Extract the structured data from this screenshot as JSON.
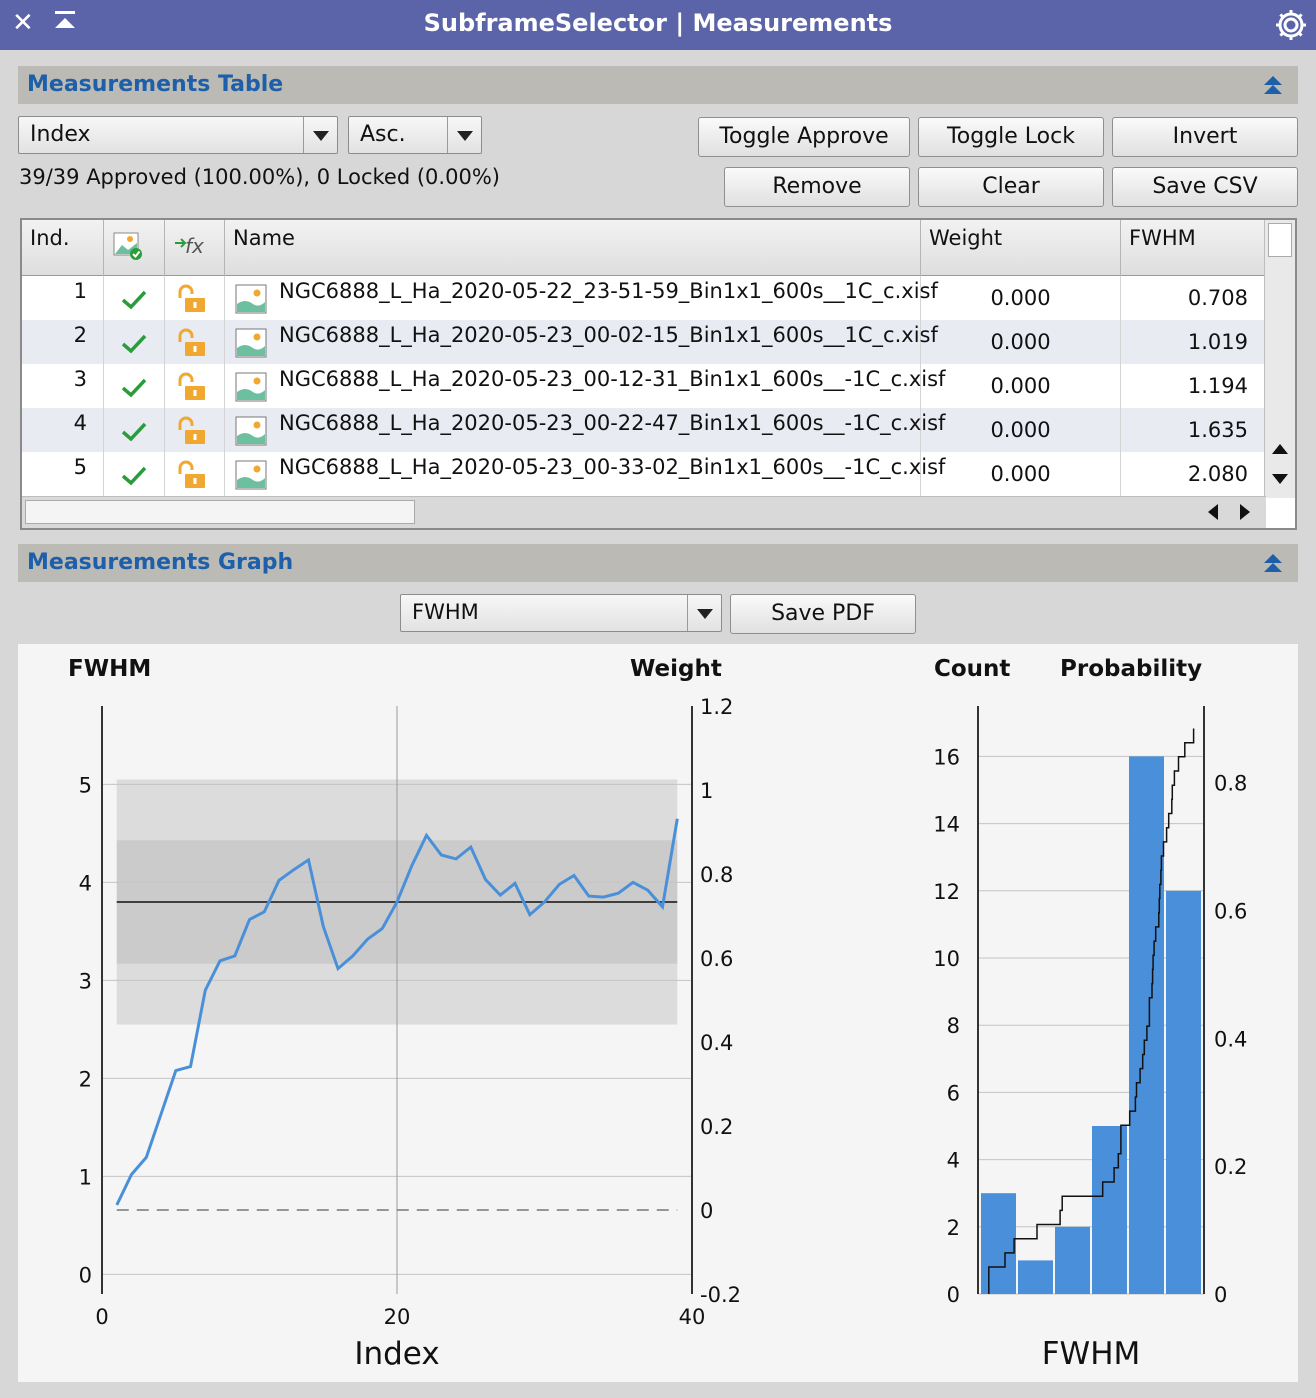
{
  "window": {
    "title": "SubframeSelector | Measurements",
    "close_icon": "close-icon",
    "shade_icon": "shade-icon",
    "settings_icon": "gear-icon"
  },
  "table_section": {
    "header": "Measurements Table",
    "sort_field": "Index",
    "sort_order": "Asc.",
    "buttons": {
      "toggle_approve": "Toggle Approve",
      "toggle_lock": "Toggle Lock",
      "invert": "Invert",
      "remove": "Remove",
      "clear": "Clear",
      "save_csv": "Save CSV"
    },
    "status": "39/39 Approved (100.00%), 0 Locked (0.00%)",
    "columns": [
      "Ind.",
      "approved-icon",
      "locked-icon",
      "Name",
      "Weight",
      "FWHM"
    ],
    "column_labels": {
      "ind": "Ind.",
      "name": "Name",
      "weight": "Weight",
      "fwhm": "FWHM"
    },
    "rows": [
      {
        "index": "1",
        "name": "NGC6888_L_Ha_2020-05-22_23-51-59_Bin1x1_600s__1C_c.xisf",
        "weight": "0.000",
        "fwhm": "0.708",
        "approved": true,
        "locked": false
      },
      {
        "index": "2",
        "name": "NGC6888_L_Ha_2020-05-23_00-02-15_Bin1x1_600s__1C_c.xisf",
        "weight": "0.000",
        "fwhm": "1.019",
        "approved": true,
        "locked": false
      },
      {
        "index": "3",
        "name": "NGC6888_L_Ha_2020-05-23_00-12-31_Bin1x1_600s__-1C_c.xisf",
        "weight": "0.000",
        "fwhm": "1.194",
        "approved": true,
        "locked": false
      },
      {
        "index": "4",
        "name": "NGC6888_L_Ha_2020-05-23_00-22-47_Bin1x1_600s__-1C_c.xisf",
        "weight": "0.000",
        "fwhm": "1.635",
        "approved": true,
        "locked": false
      },
      {
        "index": "5",
        "name": "NGC6888_L_Ha_2020-05-23_00-33-02_Bin1x1_600s__-1C_c.xisf",
        "weight": "0.000",
        "fwhm": "2.080",
        "approved": true,
        "locked": false
      }
    ]
  },
  "graph_section": {
    "header": "Measurements Graph",
    "property": "FWHM",
    "save_pdf": "Save PDF"
  },
  "colors": {
    "titlebar": "#5b64a8",
    "accent": "#1d5fa8",
    "series": "#4a90d9",
    "bar": "#4a8fd9",
    "approve_check": "#2a9d3a",
    "lock": "#f0a830"
  },
  "chart_data": [
    {
      "type": "line",
      "title": "",
      "ylabel": "FWHM",
      "y2label": "Weight",
      "xlabel": "Index",
      "xlim": [
        0,
        40
      ],
      "ylim": [
        -0.2,
        5.8
      ],
      "y2lim": [
        -0.2,
        1.2
      ],
      "x_ticks": [
        "0",
        "20",
        "40"
      ],
      "y_ticks": [
        "0",
        "1",
        "2",
        "3",
        "4",
        "5"
      ],
      "y2_ticks": [
        "-0.2",
        "0",
        "0.2",
        "0.4",
        "0.6",
        "0.8",
        "1",
        "1.2"
      ],
      "grid": true,
      "mean": 3.8,
      "sigma_bands": [
        [
          3.17,
          4.43
        ],
        [
          2.55,
          5.05
        ]
      ],
      "series": [
        {
          "x": [
            1,
            2,
            3,
            4,
            5,
            6,
            7,
            8,
            9,
            10,
            11,
            12,
            13,
            14,
            15,
            16,
            17,
            18,
            19,
            20,
            21,
            22,
            23,
            24,
            25,
            26,
            27,
            28,
            29,
            30,
            31,
            32,
            33,
            34,
            35,
            36,
            37,
            38,
            39
          ],
          "values": [
            0.708,
            1.019,
            1.194,
            1.635,
            2.08,
            2.12,
            2.9,
            3.2,
            3.25,
            3.62,
            3.7,
            4.02,
            4.13,
            4.23,
            3.55,
            3.12,
            3.25,
            3.42,
            3.53,
            3.8,
            4.17,
            4.48,
            4.28,
            4.24,
            4.36,
            4.03,
            3.87,
            3.99,
            3.67,
            3.8,
            3.98,
            4.07,
            3.86,
            3.85,
            3.89,
            4.0,
            3.92,
            3.75,
            4.65
          ]
        },
        {
          "x": [
            1,
            39
          ],
          "values": [
            0,
            0
          ]
        }
      ]
    },
    {
      "type": "bar",
      "title": "",
      "ylabel": "Count",
      "y2label": "Probability",
      "xlabel": "FWHM",
      "ylim": [
        0,
        17.5
      ],
      "y2lim": [
        0,
        0.92
      ],
      "y_ticks": [
        "0",
        "2",
        "4",
        "6",
        "8",
        "10",
        "12",
        "14",
        "16"
      ],
      "y2_ticks": [
        "0",
        "0.2",
        "0.4",
        "0.6",
        "0.8"
      ],
      "values": [
        3,
        1,
        2,
        5,
        16,
        12
      ],
      "cdf": {
        "x": [
          0.708,
          1.019,
          1.194,
          1.635,
          2.08,
          2.12,
          2.9,
          3.12,
          3.2,
          3.25,
          3.25,
          3.42,
          3.53,
          3.55,
          3.62,
          3.67,
          3.7,
          3.75,
          3.8,
          3.8,
          3.85,
          3.86,
          3.87,
          3.89,
          3.92,
          3.98,
          3.99,
          4.0,
          4.02,
          4.03,
          4.07,
          4.13,
          4.17,
          4.23,
          4.24,
          4.28,
          4.36,
          4.48,
          4.65
        ],
        "xlim": [
          0.5,
          4.85
        ]
      }
    }
  ]
}
